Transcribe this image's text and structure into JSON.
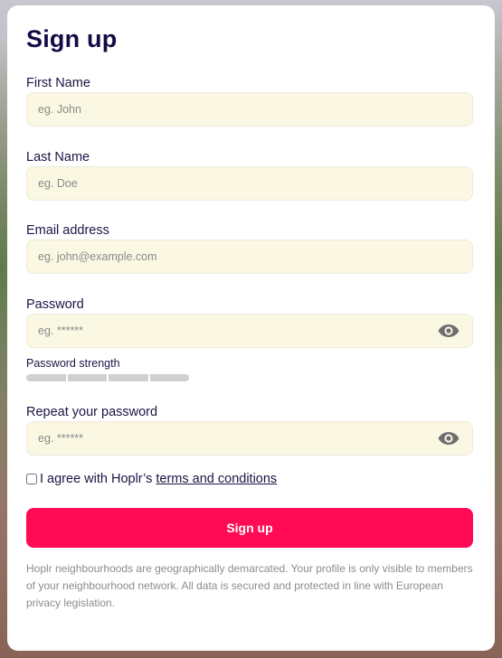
{
  "form": {
    "title": "Sign up",
    "first_name": {
      "label": "First Name",
      "placeholder": "eg. John",
      "value": ""
    },
    "last_name": {
      "label": "Last Name",
      "placeholder": "eg. Doe",
      "value": ""
    },
    "email": {
      "label": "Email address",
      "placeholder": "eg. john@example.com",
      "value": ""
    },
    "password": {
      "label": "Password",
      "placeholder": "eg. ******",
      "value": "",
      "toggle_icon": "eye-icon"
    },
    "password_strength": {
      "label": "Password strength",
      "segments": 4,
      "filled": 0
    },
    "repeat_password": {
      "label": "Repeat your password",
      "placeholder": "eg. ******",
      "value": "",
      "toggle_icon": "eye-icon"
    },
    "agree": {
      "checked": false,
      "text": "I agree with Hoplr’s",
      "link_text": "terms and conditions"
    },
    "submit_label": "Sign up",
    "note": "Hoplr neighbourhoods are geographically demarcated. Your profile is only visible to members of your neighbourhood network. All data is secured and protected in line with European privacy legislation."
  },
  "colors": {
    "title": "#150a45",
    "field_background": "#faf8e3",
    "button": "#ff0a54",
    "strength_empty": "#d0d0d0"
  }
}
